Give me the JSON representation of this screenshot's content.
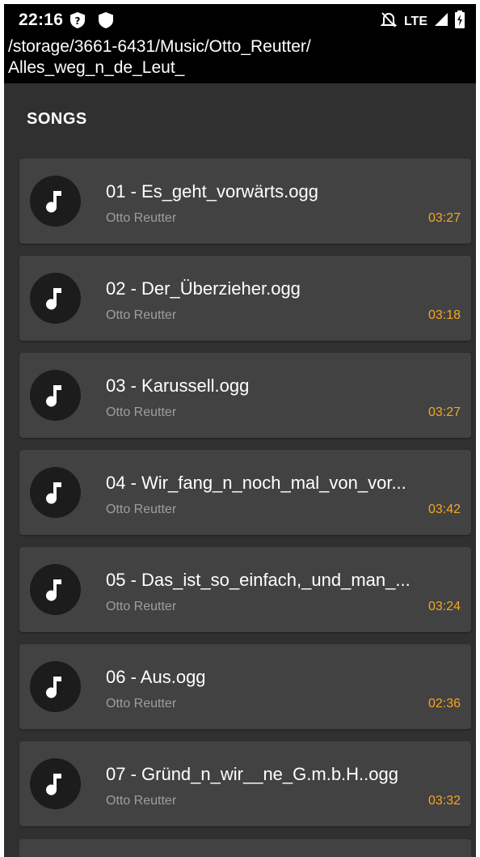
{
  "status_bar": {
    "time": "22:16",
    "network": "LTE"
  },
  "path": {
    "line1": "/storage/3661-6431/Music/Otto_Reutter/",
    "line2": "Alles_weg_n_de_Leut_"
  },
  "section_title": "SONGS",
  "colors": {
    "background": "#303030",
    "card": "#424242",
    "duration_accent": "#f5a623"
  },
  "songs": [
    {
      "title": "01 - Es_geht_vorwärts.ogg",
      "artist": "Otto Reutter",
      "duration": "03:27"
    },
    {
      "title": "02 - Der_Überzieher.ogg",
      "artist": "Otto Reutter",
      "duration": "03:18"
    },
    {
      "title": "03 - Karussell.ogg",
      "artist": "Otto Reutter",
      "duration": "03:27"
    },
    {
      "title": "04 - Wir_fang_n_noch_mal_von_vor...",
      "artist": "Otto Reutter",
      "duration": "03:42"
    },
    {
      "title": "05 - Das_ist_so_einfach,_und_man_...",
      "artist": "Otto Reutter",
      "duration": "03:24"
    },
    {
      "title": "06 - Aus.ogg",
      "artist": "Otto Reutter",
      "duration": "02:36"
    },
    {
      "title": "07 - Gründ_n_wir__ne_G.m.b.H..ogg",
      "artist": "Otto Reutter",
      "duration": "03:32"
    }
  ]
}
